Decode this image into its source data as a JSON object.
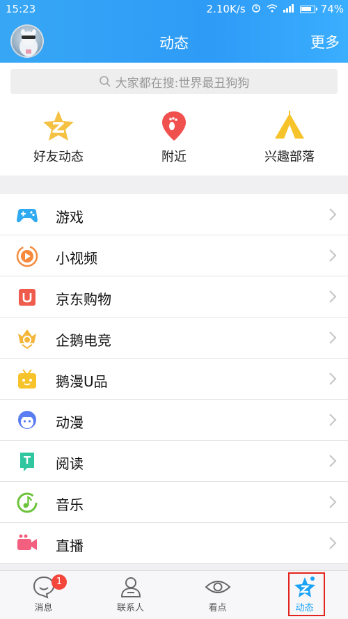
{
  "status": {
    "time": "15:23",
    "speed": "2.10K/s",
    "battery": "74%"
  },
  "header": {
    "title": "动态",
    "more_label": "更多"
  },
  "search": {
    "placeholder": "大家都在搜:世界最丑狗狗"
  },
  "shortcuts": [
    {
      "label": "好友动态",
      "icon": "friend-feed-star-icon",
      "color": "#f5c142"
    },
    {
      "label": "附近",
      "icon": "nearby-pin-icon",
      "color": "#f0514f"
    },
    {
      "label": "兴趣部落",
      "icon": "tribe-tent-icon",
      "color": "#f7c32a"
    }
  ],
  "list": [
    {
      "label": "游戏",
      "icon": "gamepad-icon",
      "color": "#2fa9f0"
    },
    {
      "label": "小视频",
      "icon": "video-play-icon",
      "color": "#f7893b"
    },
    {
      "label": "京东购物",
      "icon": "jd-u-icon",
      "color": "#ef5b4d"
    },
    {
      "label": "企鹅电竞",
      "icon": "esports-crown-icon",
      "color": "#f3b63a"
    },
    {
      "label": "鹅漫U品",
      "icon": "tv-box-icon",
      "color": "#f7c32a"
    },
    {
      "label": "动漫",
      "icon": "anime-face-icon",
      "color": "#5b7df2"
    },
    {
      "label": "阅读",
      "icon": "book-icon",
      "color": "#2fc6a0"
    },
    {
      "label": "音乐",
      "icon": "music-note-icon",
      "color": "#6cc33a"
    },
    {
      "label": "直播",
      "icon": "live-camera-icon",
      "color": "#f25f7f"
    }
  ],
  "tabs": [
    {
      "label": "消息",
      "icon": "message-icon",
      "badge": "1"
    },
    {
      "label": "联系人",
      "icon": "contacts-icon"
    },
    {
      "label": "看点",
      "icon": "eye-icon"
    },
    {
      "label": "动态",
      "icon": "star-feed-icon",
      "active": true
    }
  ],
  "colors": {
    "accent": "#1aa3f5",
    "header": "#2e9bf6",
    "badge": "#f5463b"
  }
}
